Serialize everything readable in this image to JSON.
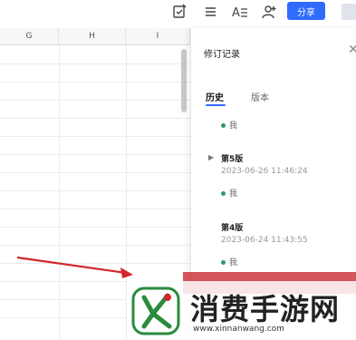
{
  "toolbar": {
    "share_label": "分享",
    "icons": [
      "edit-check-icon",
      "list-icon",
      "text-style-icon",
      "add-user-icon"
    ],
    "accent": "#2f6bff"
  },
  "sheet": {
    "columns": [
      "G",
      "H",
      "I"
    ]
  },
  "panel": {
    "title": "修订记录",
    "tabs": [
      {
        "label": "历史",
        "active": true
      },
      {
        "label": "版本",
        "active": false
      }
    ],
    "entries": [
      {
        "user": "我"
      },
      {
        "version": "第5版",
        "time": "2023-06-26 11:46:24",
        "user": "我"
      },
      {
        "version": "第4版",
        "time": "2023-06-24 11:43:55",
        "user": "我"
      }
    ]
  },
  "watermark": {
    "brand": "消费手游网",
    "url": "www.xinnanwang.com",
    "accent": "#c51c24"
  }
}
